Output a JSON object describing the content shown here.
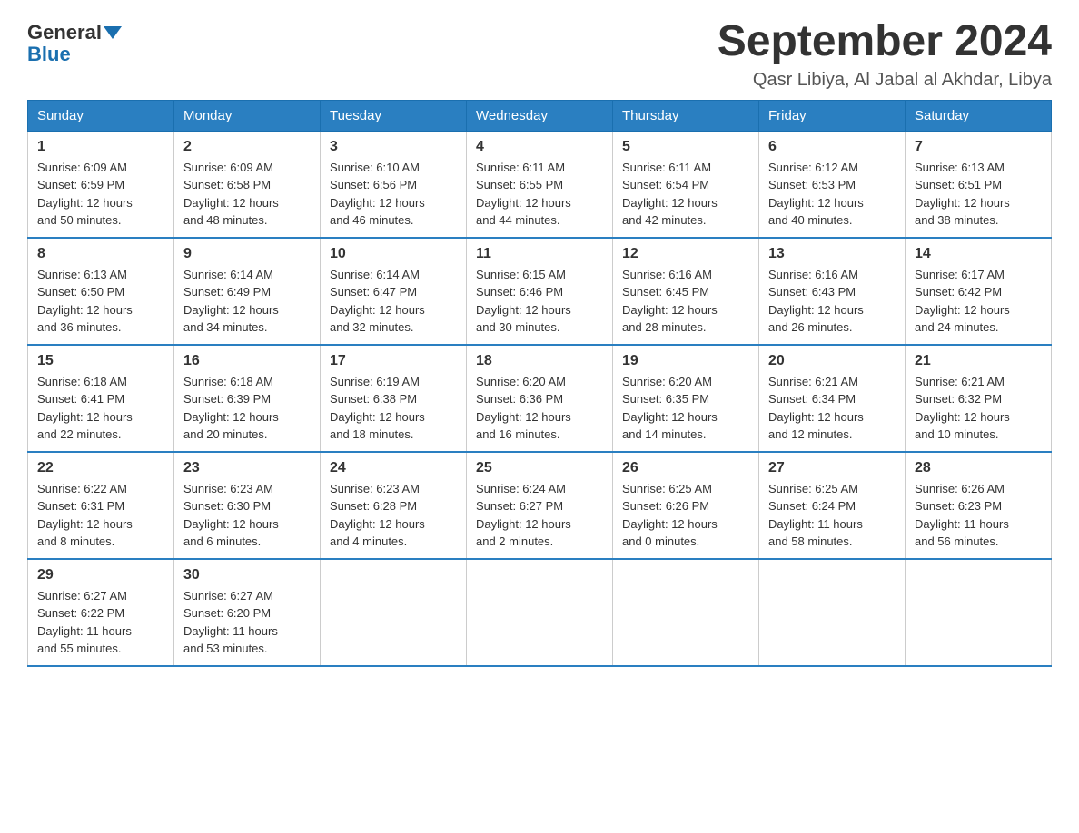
{
  "logo": {
    "text_general": "General",
    "text_blue": "Blue"
  },
  "title": "September 2024",
  "subtitle": "Qasr Libiya, Al Jabal al Akhdar, Libya",
  "weekdays": [
    "Sunday",
    "Monday",
    "Tuesday",
    "Wednesday",
    "Thursday",
    "Friday",
    "Saturday"
  ],
  "weeks": [
    [
      {
        "day": "1",
        "sunrise": "6:09 AM",
        "sunset": "6:59 PM",
        "daylight": "12 hours and 50 minutes."
      },
      {
        "day": "2",
        "sunrise": "6:09 AM",
        "sunset": "6:58 PM",
        "daylight": "12 hours and 48 minutes."
      },
      {
        "day": "3",
        "sunrise": "6:10 AM",
        "sunset": "6:56 PM",
        "daylight": "12 hours and 46 minutes."
      },
      {
        "day": "4",
        "sunrise": "6:11 AM",
        "sunset": "6:55 PM",
        "daylight": "12 hours and 44 minutes."
      },
      {
        "day": "5",
        "sunrise": "6:11 AM",
        "sunset": "6:54 PM",
        "daylight": "12 hours and 42 minutes."
      },
      {
        "day": "6",
        "sunrise": "6:12 AM",
        "sunset": "6:53 PM",
        "daylight": "12 hours and 40 minutes."
      },
      {
        "day": "7",
        "sunrise": "6:13 AM",
        "sunset": "6:51 PM",
        "daylight": "12 hours and 38 minutes."
      }
    ],
    [
      {
        "day": "8",
        "sunrise": "6:13 AM",
        "sunset": "6:50 PM",
        "daylight": "12 hours and 36 minutes."
      },
      {
        "day": "9",
        "sunrise": "6:14 AM",
        "sunset": "6:49 PM",
        "daylight": "12 hours and 34 minutes."
      },
      {
        "day": "10",
        "sunrise": "6:14 AM",
        "sunset": "6:47 PM",
        "daylight": "12 hours and 32 minutes."
      },
      {
        "day": "11",
        "sunrise": "6:15 AM",
        "sunset": "6:46 PM",
        "daylight": "12 hours and 30 minutes."
      },
      {
        "day": "12",
        "sunrise": "6:16 AM",
        "sunset": "6:45 PM",
        "daylight": "12 hours and 28 minutes."
      },
      {
        "day": "13",
        "sunrise": "6:16 AM",
        "sunset": "6:43 PM",
        "daylight": "12 hours and 26 minutes."
      },
      {
        "day": "14",
        "sunrise": "6:17 AM",
        "sunset": "6:42 PM",
        "daylight": "12 hours and 24 minutes."
      }
    ],
    [
      {
        "day": "15",
        "sunrise": "6:18 AM",
        "sunset": "6:41 PM",
        "daylight": "12 hours and 22 minutes."
      },
      {
        "day": "16",
        "sunrise": "6:18 AM",
        "sunset": "6:39 PM",
        "daylight": "12 hours and 20 minutes."
      },
      {
        "day": "17",
        "sunrise": "6:19 AM",
        "sunset": "6:38 PM",
        "daylight": "12 hours and 18 minutes."
      },
      {
        "day": "18",
        "sunrise": "6:20 AM",
        "sunset": "6:36 PM",
        "daylight": "12 hours and 16 minutes."
      },
      {
        "day": "19",
        "sunrise": "6:20 AM",
        "sunset": "6:35 PM",
        "daylight": "12 hours and 14 minutes."
      },
      {
        "day": "20",
        "sunrise": "6:21 AM",
        "sunset": "6:34 PM",
        "daylight": "12 hours and 12 minutes."
      },
      {
        "day": "21",
        "sunrise": "6:21 AM",
        "sunset": "6:32 PM",
        "daylight": "12 hours and 10 minutes."
      }
    ],
    [
      {
        "day": "22",
        "sunrise": "6:22 AM",
        "sunset": "6:31 PM",
        "daylight": "12 hours and 8 minutes."
      },
      {
        "day": "23",
        "sunrise": "6:23 AM",
        "sunset": "6:30 PM",
        "daylight": "12 hours and 6 minutes."
      },
      {
        "day": "24",
        "sunrise": "6:23 AM",
        "sunset": "6:28 PM",
        "daylight": "12 hours and 4 minutes."
      },
      {
        "day": "25",
        "sunrise": "6:24 AM",
        "sunset": "6:27 PM",
        "daylight": "12 hours and 2 minutes."
      },
      {
        "day": "26",
        "sunrise": "6:25 AM",
        "sunset": "6:26 PM",
        "daylight": "12 hours and 0 minutes."
      },
      {
        "day": "27",
        "sunrise": "6:25 AM",
        "sunset": "6:24 PM",
        "daylight": "11 hours and 58 minutes."
      },
      {
        "day": "28",
        "sunrise": "6:26 AM",
        "sunset": "6:23 PM",
        "daylight": "11 hours and 56 minutes."
      }
    ],
    [
      {
        "day": "29",
        "sunrise": "6:27 AM",
        "sunset": "6:22 PM",
        "daylight": "11 hours and 55 minutes."
      },
      {
        "day": "30",
        "sunrise": "6:27 AM",
        "sunset": "6:20 PM",
        "daylight": "11 hours and 53 minutes."
      },
      null,
      null,
      null,
      null,
      null
    ]
  ],
  "labels": {
    "sunrise": "Sunrise:",
    "sunset": "Sunset:",
    "daylight": "Daylight:"
  }
}
